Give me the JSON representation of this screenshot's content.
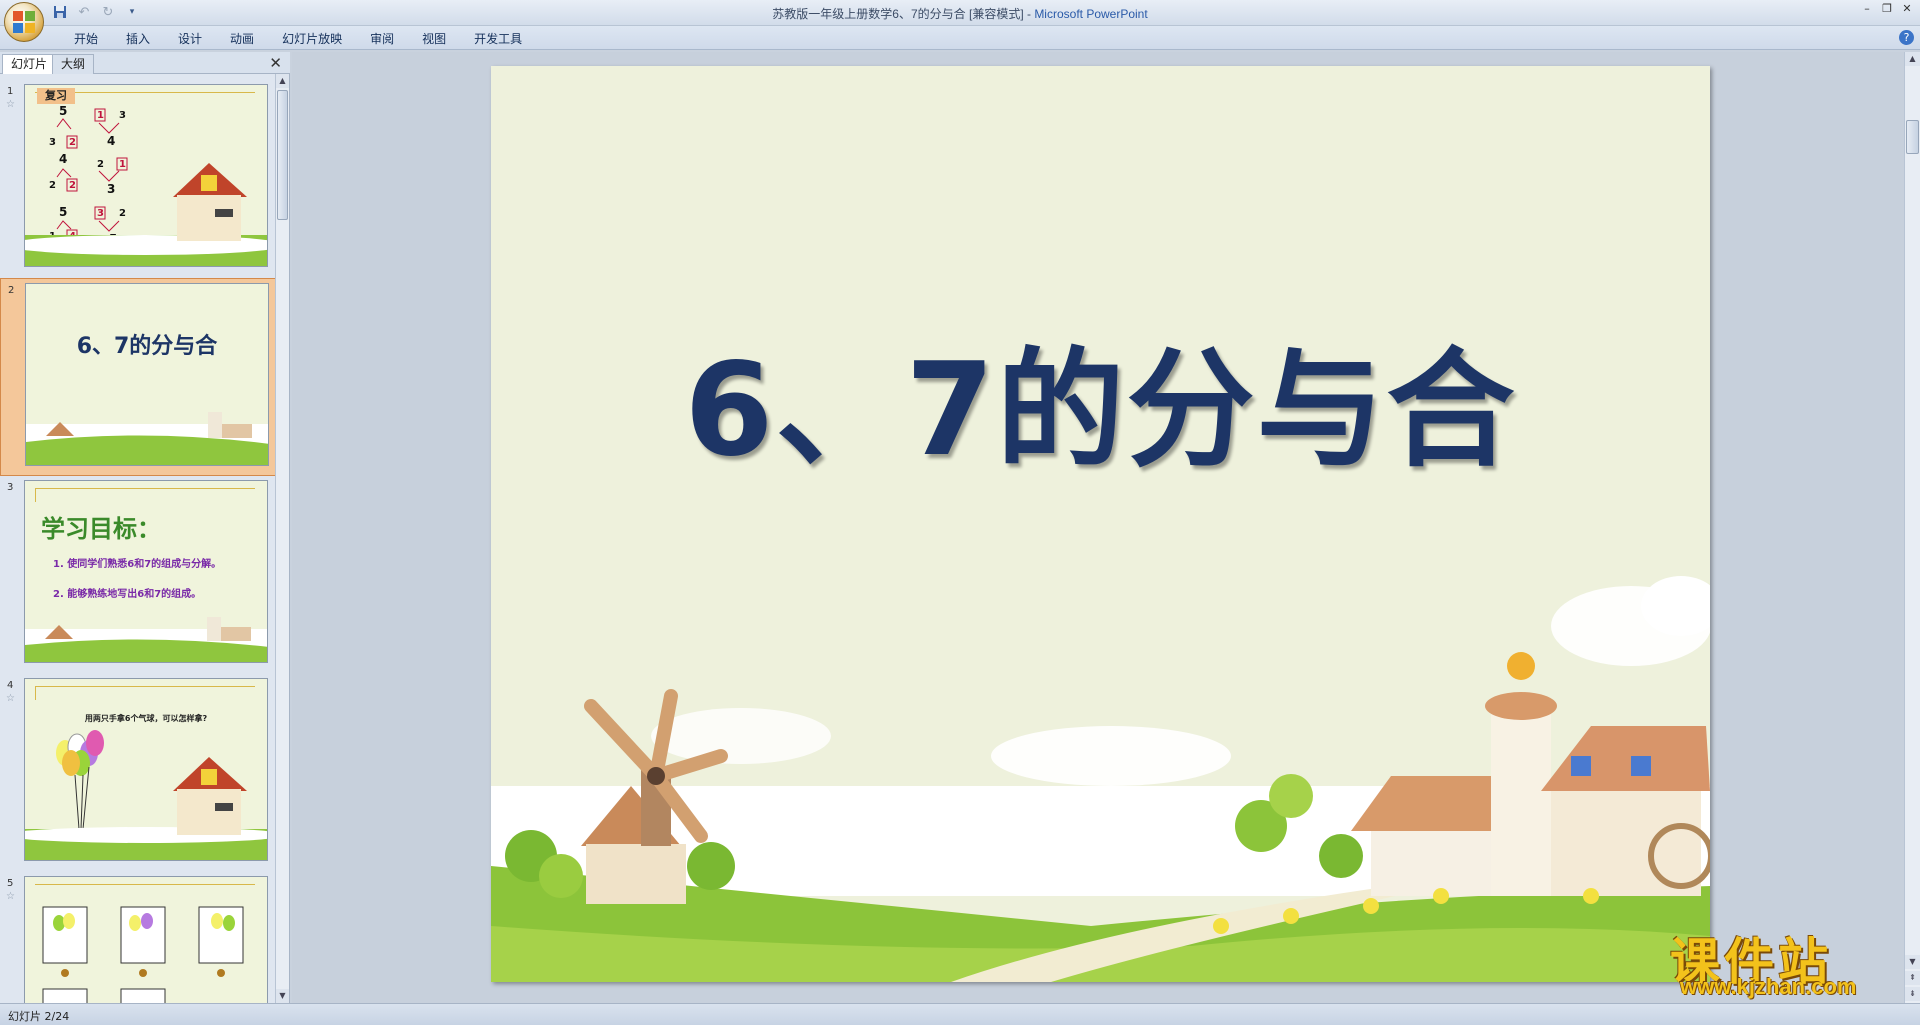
{
  "window": {
    "title": "苏教版一年级上册数学6、7的分与合 [兼容模式] - ",
    "app_name": "Microsoft PowerPoint"
  },
  "ribbon": {
    "tabs": [
      "开始",
      "插入",
      "设计",
      "动画",
      "幻灯片放映",
      "审阅",
      "视图",
      "开发工具"
    ]
  },
  "left_pane": {
    "tabs": [
      "幻灯片",
      "大纲"
    ],
    "thumbnails": [
      {
        "number": "1",
        "label": "复习",
        "items": [
          "5",
          "3",
          "2",
          "1",
          "3",
          "4",
          "4",
          "2",
          "2",
          "2",
          "1",
          "3",
          "5",
          "1",
          "4",
          "3",
          "2",
          "5"
        ]
      },
      {
        "number": "2",
        "title": "6、7的分与合"
      },
      {
        "number": "3",
        "heading": "学习目标：",
        "lines": [
          "1. 使同学们熟悉6和7的组成与分解。",
          "2. 能够熟练地写出6和7的组成。"
        ]
      },
      {
        "number": "4",
        "text": "用两只手拿6个气球，可以怎样拿?"
      },
      {
        "number": "5"
      }
    ]
  },
  "slide": {
    "title": "6、7的分与合"
  },
  "status": {
    "text": "幻灯片 2/24"
  },
  "watermark": {
    "cn": "课件站",
    "url": "www.kjzhan.com"
  }
}
